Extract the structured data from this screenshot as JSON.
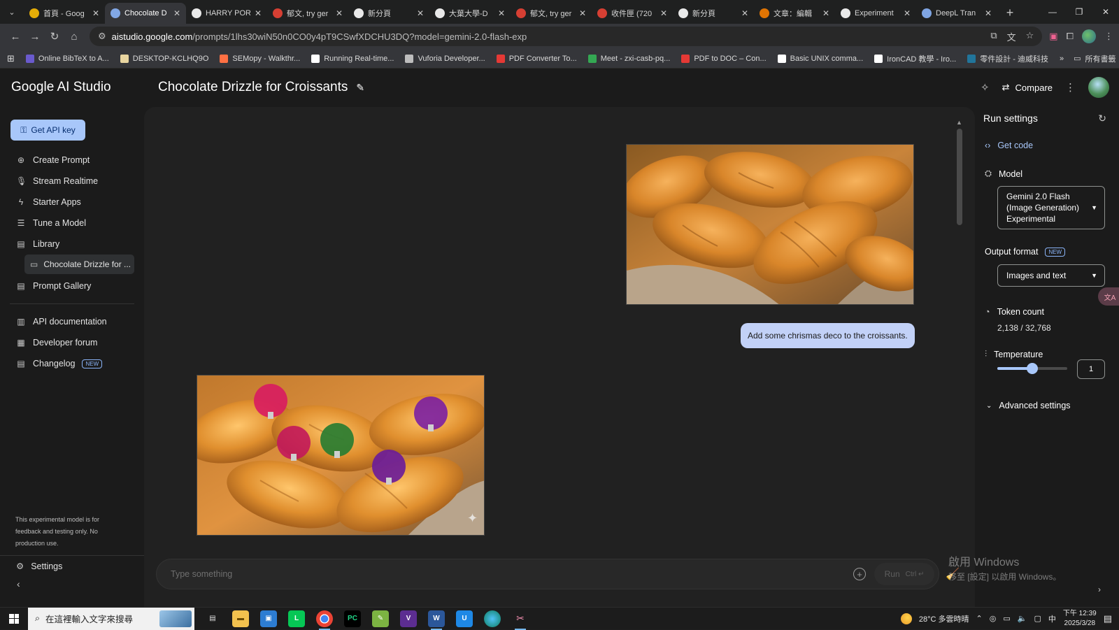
{
  "browser": {
    "tabs": [
      {
        "title": "首頁 - Goog",
        "icon": "drive-icon",
        "color": "#fbbc04"
      },
      {
        "title": "Chocolate D",
        "icon": "aistudio-icon",
        "color": "#8ab4f8",
        "active": true
      },
      {
        "title": "HARRY POR",
        "icon": "google-icon",
        "color": "#ffffff"
      },
      {
        "title": "郁文, try ger",
        "icon": "gmail-icon",
        "color": "#ea4335"
      },
      {
        "title": "新分頁",
        "icon": "chrome-icon",
        "color": "#ffffff"
      },
      {
        "title": "大葉大學-D",
        "icon": "globe-icon",
        "color": "#ffffff"
      },
      {
        "title": "郁文, try ger",
        "icon": "gmail-icon",
        "color": "#ea4335"
      },
      {
        "title": "收件匣 (720",
        "icon": "gmail-icon",
        "color": "#ea4335"
      },
      {
        "title": "新分頁",
        "icon": "chrome-icon",
        "color": "#ffffff"
      },
      {
        "title": "文章：編輯",
        "icon": "blogger-icon",
        "color": "#f57d00"
      },
      {
        "title": "Experiment",
        "icon": "google-icon",
        "color": "#ffffff"
      },
      {
        "title": "DeepL Tran",
        "icon": "deepl-icon",
        "color": "#8ab4f8"
      }
    ],
    "url_host": "aistudio.google.com",
    "url_path": "/prompts/1lhs30wiN50n0CO0y4pT9CSwfXDCHU3DQ?model=gemini-2.0-flash-exp",
    "bookmarks": [
      {
        "label": "Online BibTeX to A...",
        "color": "#6a5acd"
      },
      {
        "label": "DESKTOP-KCLHQ9O",
        "color": "#e8d5a0"
      },
      {
        "label": "SEMopy - Walkthr...",
        "color": "#ff7043"
      },
      {
        "label": "Running Real-time...",
        "color": "#ffffff"
      },
      {
        "label": "Vuforia Developer...",
        "color": "#bdbdbd"
      },
      {
        "label": "PDF Converter To...",
        "color": "#e53935"
      },
      {
        "label": "Meet - zxi-casb-pq...",
        "color": "#34a853"
      },
      {
        "label": "PDF to DOC – Con...",
        "color": "#e53935"
      },
      {
        "label": "Basic UNIX comma...",
        "color": "#ffffff"
      },
      {
        "label": "IronCAD 教學 - Iro...",
        "color": "#ffffff"
      },
      {
        "label": "零件設計 - 迪威科技",
        "color": "#21759b"
      }
    ],
    "bookmarks_all": "所有書籤"
  },
  "app": {
    "brand": "Google AI Studio",
    "prompt_title": "Chocolate Drizzle for Croissants",
    "compare_label": "Compare"
  },
  "sidebar": {
    "api_key_label": "Get API key",
    "items": [
      {
        "label": "Create Prompt",
        "icon": "create-prompt-icon"
      },
      {
        "label": "Stream Realtime",
        "icon": "microphone-icon"
      },
      {
        "label": "Starter Apps",
        "icon": "bolt-icon"
      },
      {
        "label": "Tune a Model",
        "icon": "tune-icon"
      },
      {
        "label": "Library",
        "icon": "library-icon"
      }
    ],
    "library_item": "Chocolate Drizzle for ...",
    "gallery_label": "Prompt Gallery",
    "links": [
      {
        "label": "API documentation"
      },
      {
        "label": "Developer forum"
      },
      {
        "label": "Changelog",
        "badge": "NEW"
      }
    ],
    "note": "This experimental model is for feedback and testing only. No production use.",
    "settings_label": "Settings"
  },
  "chat": {
    "user_message": "Add some chrismas deco to the croissants.",
    "composer_placeholder": "Type something",
    "run_label": "Run",
    "run_shortcut": "Ctrl"
  },
  "run_settings": {
    "title": "Run settings",
    "get_code": "Get code",
    "model_label": "Model",
    "model_value": "Gemini 2.0 Flash (Image Generation) Experimental",
    "output_format_label": "Output format",
    "output_format_badge": "NEW",
    "output_format_value": "Images and text",
    "token_count_label": "Token count",
    "token_count_value": "2,138 / 32,768",
    "temperature_label": "Temperature",
    "temperature_value": "1",
    "temperature_fraction": 0.5,
    "advanced_label": "Advanced settings"
  },
  "windows": {
    "watermark_line1": "啟用 Windows",
    "watermark_line2": "移至 [設定] 以啟用 Windows。",
    "search_placeholder": "在這裡輸入文字來搜尋",
    "weather": "28°C 多雲時晴",
    "ime": "中",
    "time": "下午 12:39",
    "date": "2025/3/28"
  },
  "colors": {
    "accent": "#a8c7fa",
    "link": "#a8c7fa",
    "user_bubble": "#c2d1f7",
    "bg_panel": "#212121"
  }
}
